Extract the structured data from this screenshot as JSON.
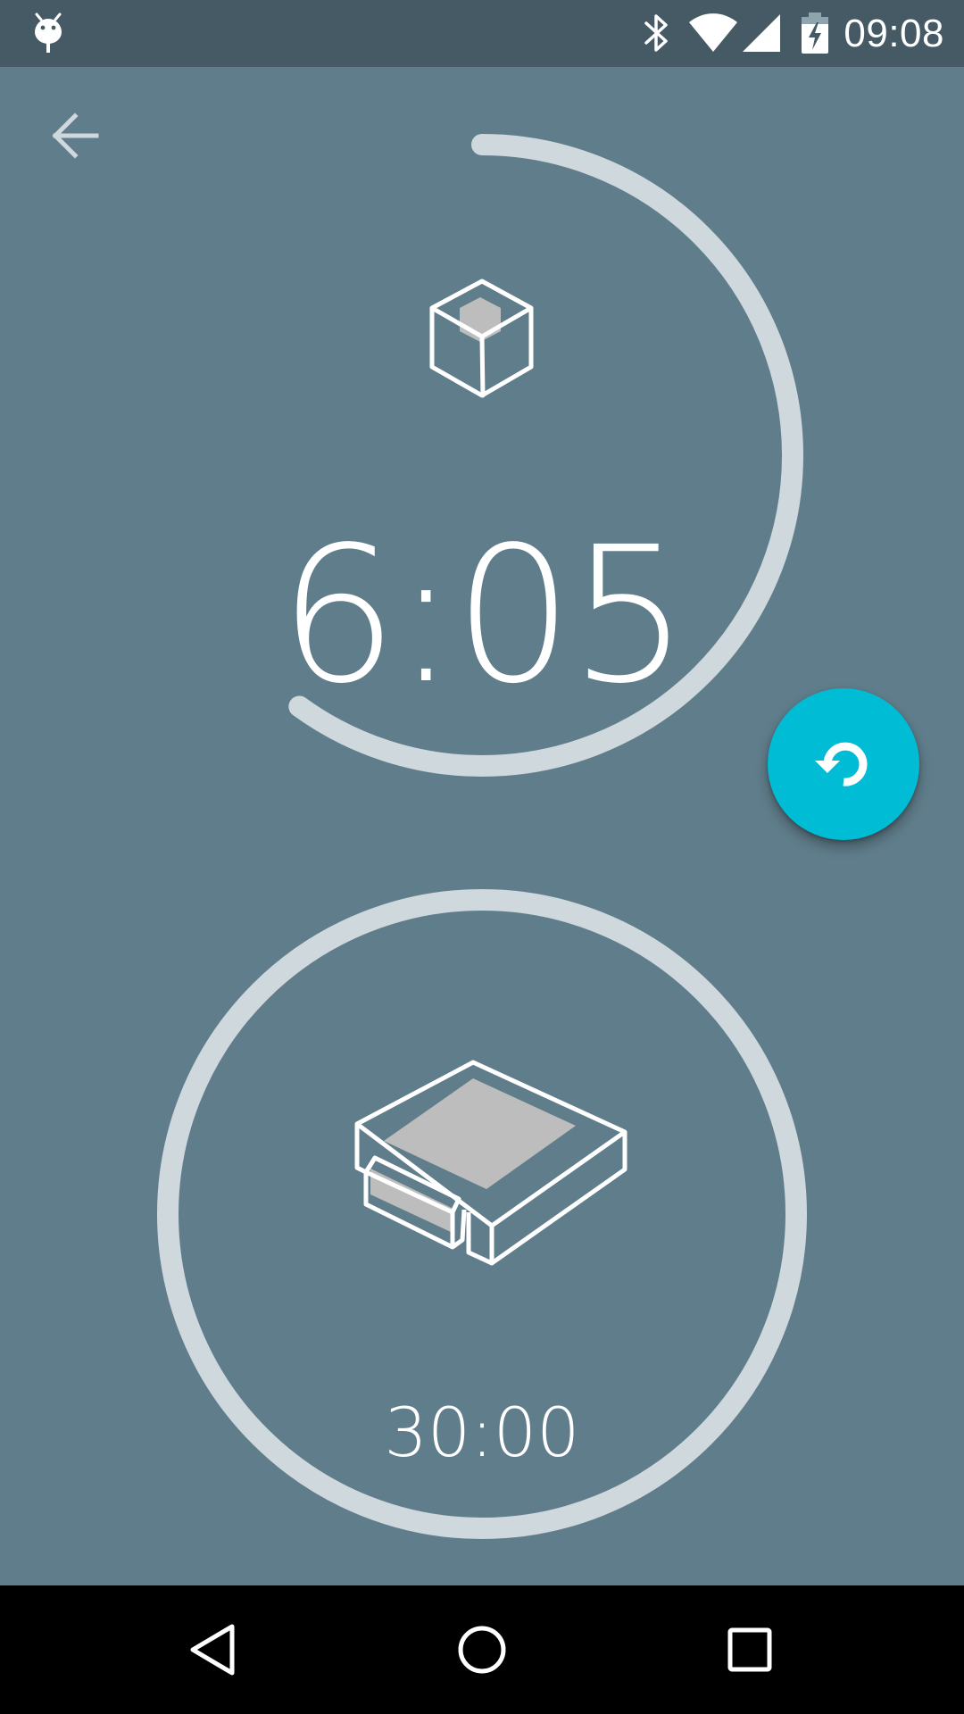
{
  "status_bar": {
    "time": "09:08",
    "icons": [
      "android-debug-icon",
      "bluetooth-icon",
      "wifi-icon",
      "signal-icon",
      "battery-charging-icon"
    ]
  },
  "toolbar": {
    "back_icon": "arrow-left-icon"
  },
  "timers": {
    "main": {
      "value": "6:05",
      "icon": "cube-icon",
      "progress": 0.6
    },
    "secondary": {
      "value": "30:00",
      "icon": "tray-box-icon",
      "progress": 1.0
    }
  },
  "fab": {
    "icon": "reset-icon"
  },
  "nav_bar": {
    "icons": [
      "back-triangle-icon",
      "home-circle-icon",
      "recents-square-icon"
    ]
  },
  "colors": {
    "background": "#607d8b",
    "status_bar": "#455a64",
    "ring": "#cfd8dc",
    "accent": "#00bcd4",
    "nav_bar": "#000000"
  }
}
